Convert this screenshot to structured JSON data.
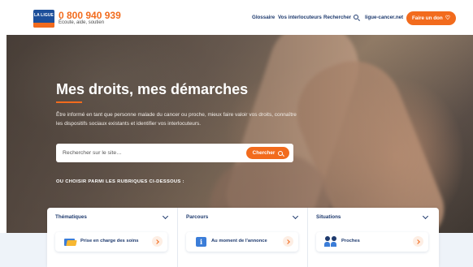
{
  "header": {
    "logo_text": "LA LIGUE",
    "phone": "0 800 940 939",
    "tagline": "Écoute, aide, soutien",
    "nav": {
      "glossaire": "Glossaire",
      "interlocuteurs": "Vos interlocuteurs",
      "rechercher": "Rechercher",
      "site": "ligue-cancer.net"
    },
    "donate_label": "Faire un don",
    "colors": {
      "brand_blue": "#1d4f9a",
      "accent_orange": "#f26b1d",
      "nav_text": "#1e3a6e"
    }
  },
  "hero": {
    "title": "Mes droits, mes démarches",
    "description": "Être informé en tant que personne malade du cancer ou proche, mieux faire valoir vos droits, connaître les dispositifs sociaux existants et identifier vos interlocuteurs.",
    "search": {
      "placeholder": "Rechercher sur le site…",
      "button_label": "Chercher"
    },
    "rubriques_label": "OU CHOISIR PARMI LES RUBRIQUES CI-DESSOUS :"
  },
  "panel": {
    "columns": [
      {
        "heading": "Thématiques",
        "card_label": "Prise en charge des soins",
        "card_icon": "folder-icon"
      },
      {
        "heading": "Parcours",
        "card_label": "Au moment de l'annonce",
        "card_icon": "info-icon"
      },
      {
        "heading": "Situations",
        "card_label": "Proches",
        "card_icon": "people-icon"
      }
    ]
  }
}
